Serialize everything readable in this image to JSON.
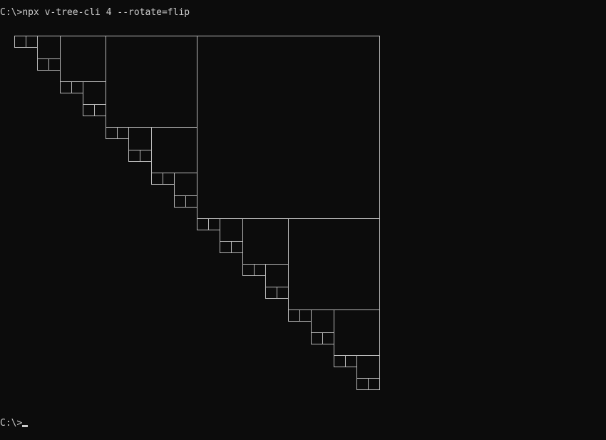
{
  "terminal": {
    "command_prompt": "C:\\>",
    "command": "npx v-tree-cli 4 --rotate=flip",
    "current_prompt": "C:\\>"
  },
  "colors": {
    "background": "#0c0c0c",
    "foreground": "#cccccc",
    "tree_stroke": "#b9b9b9"
  }
}
